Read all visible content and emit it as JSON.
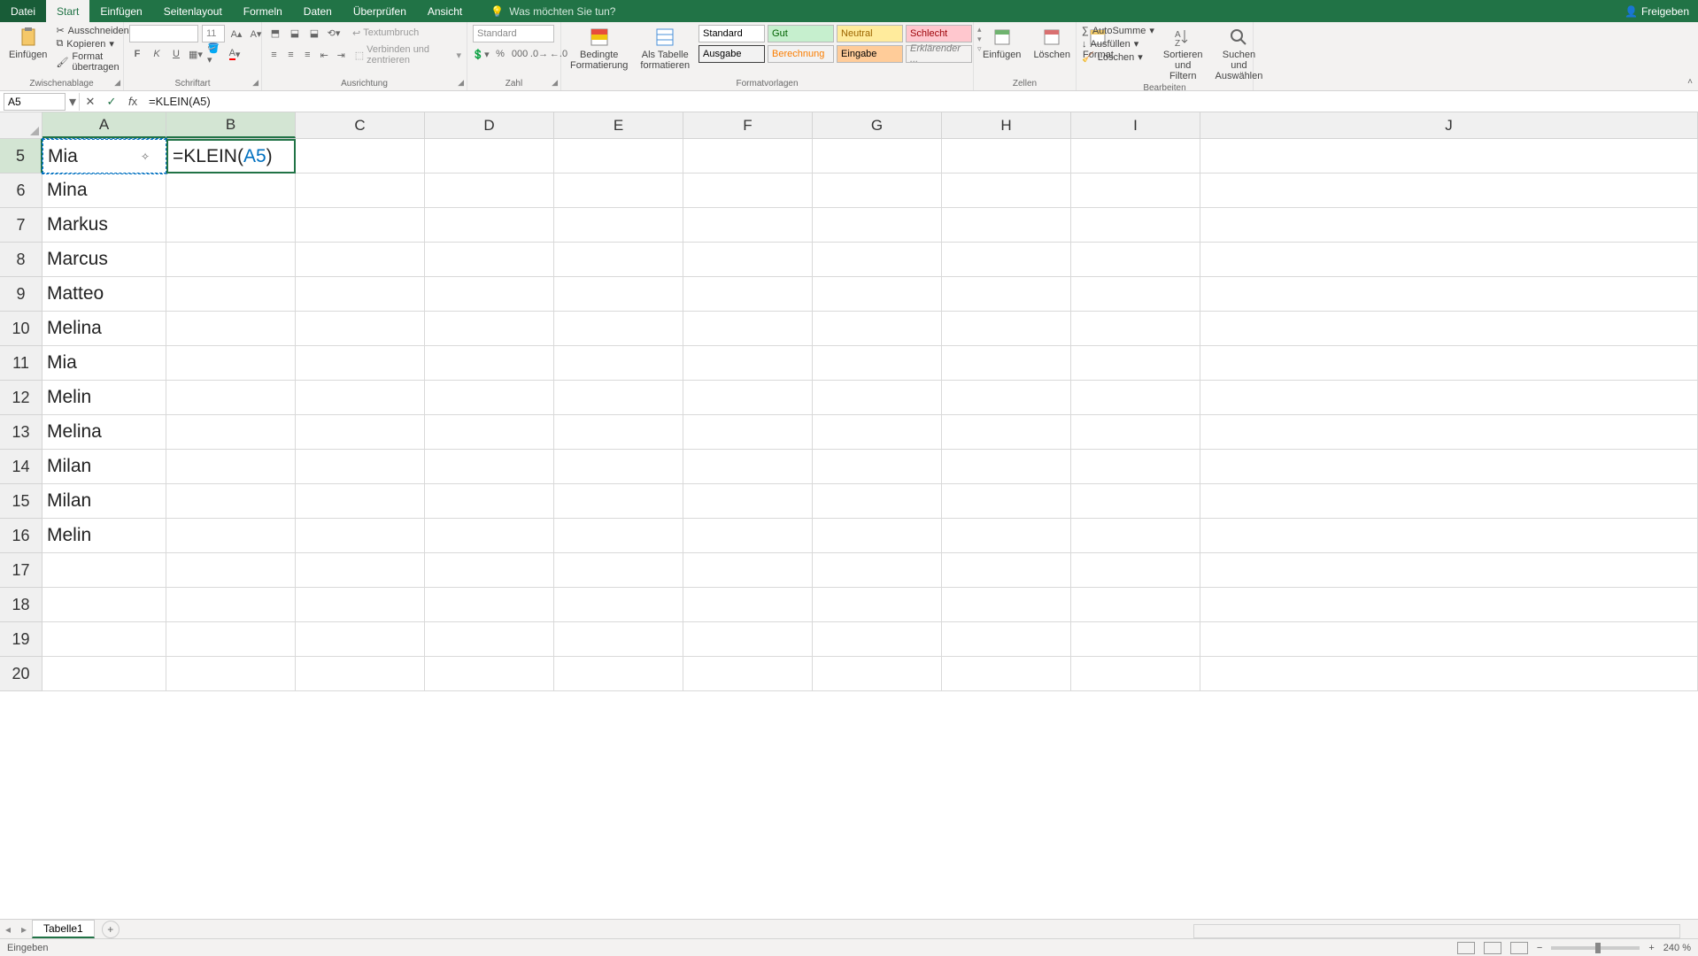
{
  "titlebar": {
    "tabs": [
      "Datei",
      "Start",
      "Einfügen",
      "Seitenlayout",
      "Formeln",
      "Daten",
      "Überprüfen",
      "Ansicht"
    ],
    "active_tab": "Start",
    "tellme_placeholder": "Was möchten Sie tun?",
    "share": "Freigeben"
  },
  "ribbon": {
    "clipboard": {
      "paste": "Einfügen",
      "cut": "Ausschneiden",
      "copy": "Kopieren",
      "painter": "Format übertragen",
      "label": "Zwischenablage"
    },
    "font": {
      "size": "11",
      "label": "Schriftart"
    },
    "alignment": {
      "wrap": "Textumbruch",
      "merge": "Verbinden und zentrieren",
      "label": "Ausrichtung"
    },
    "number": {
      "format": "Standard",
      "label": "Zahl"
    },
    "styles": {
      "cond": "Bedingte Formatierung",
      "table": "Als Tabelle formatieren",
      "cells": [
        "Standard",
        "Gut",
        "Neutral",
        "Schlecht",
        "Ausgabe",
        "Berechnung",
        "Eingabe",
        "Erklärender ..."
      ],
      "label": "Formatvorlagen"
    },
    "cells": {
      "insert": "Einfügen",
      "delete": "Löschen",
      "format": "Format",
      "label": "Zellen"
    },
    "editing": {
      "autosum": "AutoSumme",
      "fill": "Ausfüllen",
      "clear": "Löschen",
      "sort": "Sortieren und Filtern",
      "find": "Suchen und Auswählen",
      "label": "Bearbeiten"
    }
  },
  "formulabar": {
    "namebox": "A5",
    "formula": "=KLEIN(A5)"
  },
  "grid": {
    "columns": [
      "A",
      "B",
      "C",
      "D",
      "E",
      "F",
      "G",
      "H",
      "I",
      "J"
    ],
    "rows": [
      {
        "n": 5,
        "a": "Mia",
        "b": "=KLEIN(",
        "b_ref": "A5",
        "b_tail": ")"
      },
      {
        "n": 6,
        "a": "Mina"
      },
      {
        "n": 7,
        "a": "Markus"
      },
      {
        "n": 8,
        "a": "Marcus"
      },
      {
        "n": 9,
        "a": "Matteo"
      },
      {
        "n": 10,
        "a": "Melina"
      },
      {
        "n": 11,
        "a": "Mia"
      },
      {
        "n": 12,
        "a": "Melin"
      },
      {
        "n": 13,
        "a": "Melina"
      },
      {
        "n": 14,
        "a": "Milan"
      },
      {
        "n": 15,
        "a": "Milan"
      },
      {
        "n": 16,
        "a": "Melin"
      },
      {
        "n": 17,
        "a": ""
      },
      {
        "n": 18,
        "a": ""
      },
      {
        "n": 19,
        "a": ""
      },
      {
        "n": 20,
        "a": ""
      }
    ]
  },
  "sheet": {
    "name": "Tabelle1"
  },
  "status": {
    "mode": "Eingeben",
    "zoom": "240 %"
  }
}
